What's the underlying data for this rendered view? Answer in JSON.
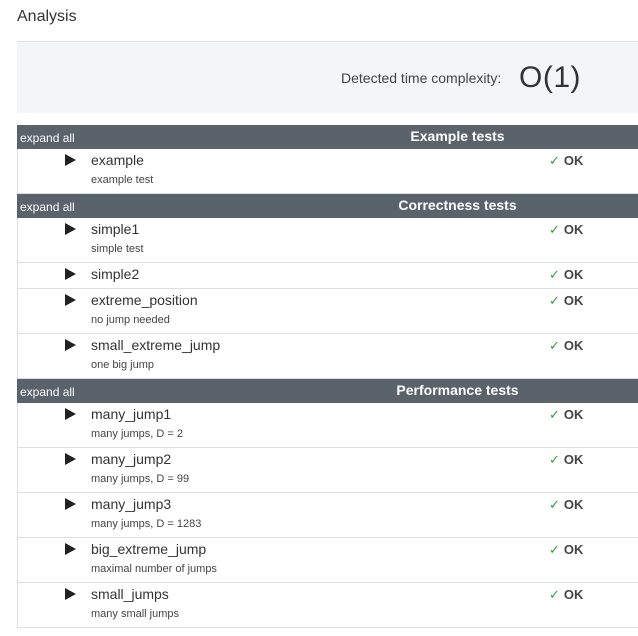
{
  "page": {
    "title": "Analysis"
  },
  "complexity": {
    "label": "Detected time complexity:",
    "value": "O(1)"
  },
  "colors": {
    "header_bg": "#5a626b",
    "ok_check": "#2e9e3a",
    "summary_bg": "#f4f5f7"
  },
  "groups": [
    {
      "expand_label": "expand all",
      "title": "Example tests",
      "tests": [
        {
          "name": "example",
          "desc": "example test",
          "status": "OK"
        }
      ]
    },
    {
      "expand_label": "expand all",
      "title": "Correctness tests",
      "tests": [
        {
          "name": "simple1",
          "desc": "simple test",
          "status": "OK"
        },
        {
          "name": "simple2",
          "desc": "",
          "status": "OK"
        },
        {
          "name": "extreme_position",
          "desc": "no jump needed",
          "status": "OK"
        },
        {
          "name": "small_extreme_jump",
          "desc": "one big jump",
          "status": "OK"
        }
      ]
    },
    {
      "expand_label": "expand all",
      "title": "Performance tests",
      "tests": [
        {
          "name": "many_jump1",
          "desc": "many jumps, D = 2",
          "status": "OK"
        },
        {
          "name": "many_jump2",
          "desc": "many jumps, D = 99",
          "status": "OK"
        },
        {
          "name": "many_jump3",
          "desc": "many jumps, D = 1283",
          "status": "OK"
        },
        {
          "name": "big_extreme_jump",
          "desc": "maximal number of jumps",
          "status": "OK"
        },
        {
          "name": "small_jumps",
          "desc": "many small jumps",
          "status": "OK"
        }
      ]
    }
  ]
}
